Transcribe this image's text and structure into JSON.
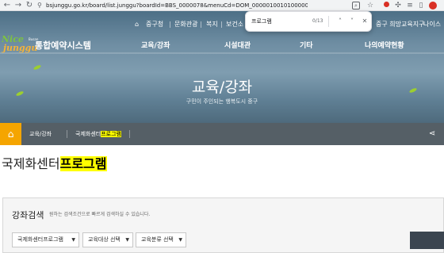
{
  "browser": {
    "url": "bsjunggu.go.kr/board/list.junggu?boardId=BBS_0000078&menuCd=DOM_000001001010000000&contentsSid=2405",
    "url_icon": "site-info-icon",
    "back_icon": "back-arrow-icon",
    "forward_icon": "forward-arrow-icon",
    "reload_icon": "reload-icon"
  },
  "find_bar": {
    "query": "프로그램",
    "count": "0/13"
  },
  "header": {
    "utility": [
      "중구청",
      "문화관광",
      "복지",
      "보건소"
    ],
    "utility_right": [
      "중구 희망교육지구",
      "나이스"
    ],
    "logo_line1": "Nice",
    "logo_line2": "junggu",
    "logo_tag": "Busan",
    "site_name": "통합예약시스템",
    "nav": [
      "교육/강좌",
      "시설대관",
      "기타",
      "나의예약현황"
    ]
  },
  "hero": {
    "title": "교육/강좌",
    "subtitle": "구민이 주인되는 행복도시 중구"
  },
  "breadcrumb": {
    "items": [
      "교육/강좌",
      "국제화센터"
    ],
    "highlight": "프로그램"
  },
  "page": {
    "title_prefix": "국제화센터",
    "title_highlight": "프로그램"
  },
  "search": {
    "title": "강좌검색",
    "description": "원하는 검색조건으로 빠르게 검색하실 수 있습니다.",
    "selects": [
      "국제화센터프로그램",
      "교육대상 선택",
      "교육분류 선택"
    ]
  },
  "colors": {
    "accent_orange": "#f5a500",
    "highlight": "#ffff00",
    "breadcrumb_bg": "#555f66"
  }
}
